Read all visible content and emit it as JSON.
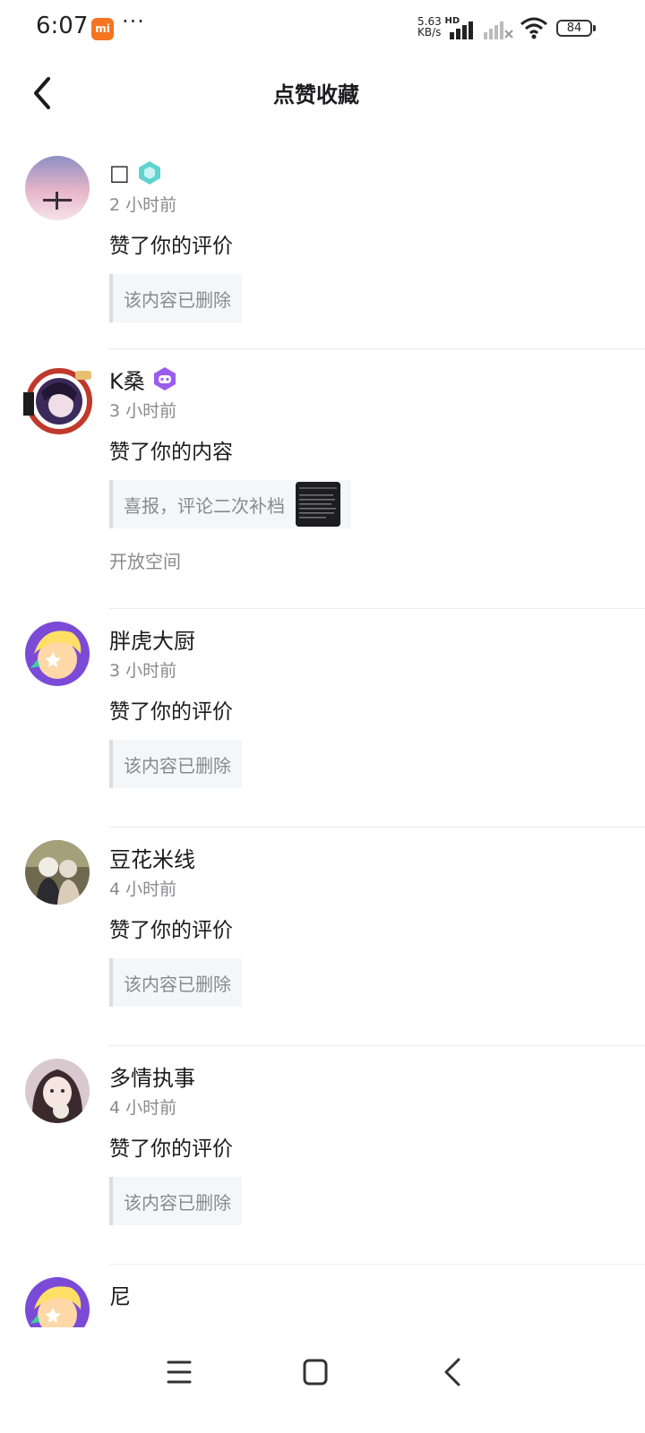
{
  "status_bar": {
    "time": "6:07",
    "app_badge": "mi",
    "more_dots": "···",
    "net_speed_value": "5.63",
    "net_speed_unit": "KB/s",
    "network_type": "HD",
    "battery": "84"
  },
  "header": {
    "title": "点赞收藏",
    "back_icon": "chevron-left-icon"
  },
  "feed": {
    "items": [
      {
        "name": "□",
        "badge": "hexagon-badge-teal",
        "time": "2 小时前",
        "action": "赞了你的评价",
        "quote": "该内容已删除",
        "has_thumb": false,
        "source": ""
      },
      {
        "name": "K桑",
        "badge": "gamepad-badge-purple",
        "time": "3 小时前",
        "action": "赞了你的内容",
        "quote": "喜报，评论二次补档",
        "has_thumb": true,
        "source": "开放空间"
      },
      {
        "name": "胖虎大厨",
        "badge": "",
        "time": "3 小时前",
        "action": "赞了你的评价",
        "quote": "该内容已删除",
        "has_thumb": false,
        "source": ""
      },
      {
        "name": "豆花米线",
        "badge": "",
        "time": "4 小时前",
        "action": "赞了你的评价",
        "quote": "该内容已删除",
        "has_thumb": false,
        "source": ""
      },
      {
        "name": "多情执事",
        "badge": "",
        "time": "4 小时前",
        "action": "赞了你的评价",
        "quote": "该内容已删除",
        "has_thumb": false,
        "source": ""
      },
      {
        "name": "尼",
        "badge": "",
        "time": "",
        "action": "",
        "quote": "",
        "has_thumb": false,
        "source": ""
      }
    ]
  },
  "nav_bar": {
    "menu_icon": "menu-icon",
    "home_icon": "home-square-icon",
    "back_icon": "back-triangle-icon"
  },
  "colors": {
    "muted_text": "#8a8a8e",
    "quote_bg": "#f5f6f8",
    "teal_badge": "#5fd3cf",
    "purple_badge": "#9b5cf0"
  }
}
